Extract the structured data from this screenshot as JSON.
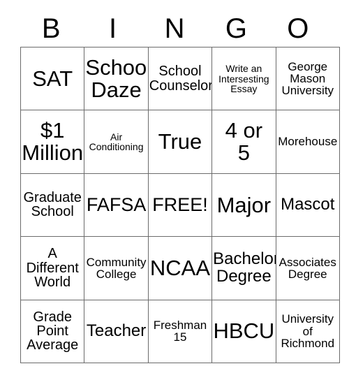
{
  "card": {
    "header_letters": [
      "B",
      "I",
      "N",
      "G",
      "O"
    ],
    "rows": [
      [
        {
          "text": "SAT",
          "size": "fs-xxl"
        },
        {
          "text": "School\nDaze",
          "size": "fs-xxl"
        },
        {
          "text": "School\nCounselor",
          "size": "fs-md"
        },
        {
          "text": "Write an\nIntersesting\nEssay",
          "size": "fs-xs"
        },
        {
          "text": "George\nMason\nUniversity",
          "size": "fs-sm"
        }
      ],
      [
        {
          "text": "$1\nMillion",
          "size": "fs-xxl"
        },
        {
          "text": "Air\nConditioning",
          "size": "fs-xs"
        },
        {
          "text": "True",
          "size": "fs-xxl"
        },
        {
          "text": "4 or\n5",
          "size": "fs-xxl"
        },
        {
          "text": "Morehouse",
          "size": "fs-sm"
        }
      ],
      [
        {
          "text": "Graduate\nSchool",
          "size": "fs-md"
        },
        {
          "text": "FAFSA",
          "size": "fs-xl"
        },
        {
          "text": "FREE!",
          "size": "fs-xl"
        },
        {
          "text": "Major",
          "size": "fs-xxl"
        },
        {
          "text": "Mascot",
          "size": "fs-lg"
        }
      ],
      [
        {
          "text": "A\nDifferent\nWorld",
          "size": "fs-md"
        },
        {
          "text": "Community\nCollege",
          "size": "fs-sm"
        },
        {
          "text": "NCAA",
          "size": "fs-xxl"
        },
        {
          "text": "Bachelor\nDegree",
          "size": "fs-lg"
        },
        {
          "text": "Associates\nDegree",
          "size": "fs-sm"
        }
      ],
      [
        {
          "text": "Grade\nPoint\nAverage",
          "size": "fs-md"
        },
        {
          "text": "Teacher",
          "size": "fs-lg"
        },
        {
          "text": "Freshman\n15",
          "size": "fs-sm"
        },
        {
          "text": "HBCU",
          "size": "fs-xxl"
        },
        {
          "text": "University\nof\nRichmond",
          "size": "fs-sm"
        }
      ]
    ]
  },
  "colors": {
    "background": "#ffffff",
    "text": "#000000",
    "border": "#6b6b6b"
  }
}
